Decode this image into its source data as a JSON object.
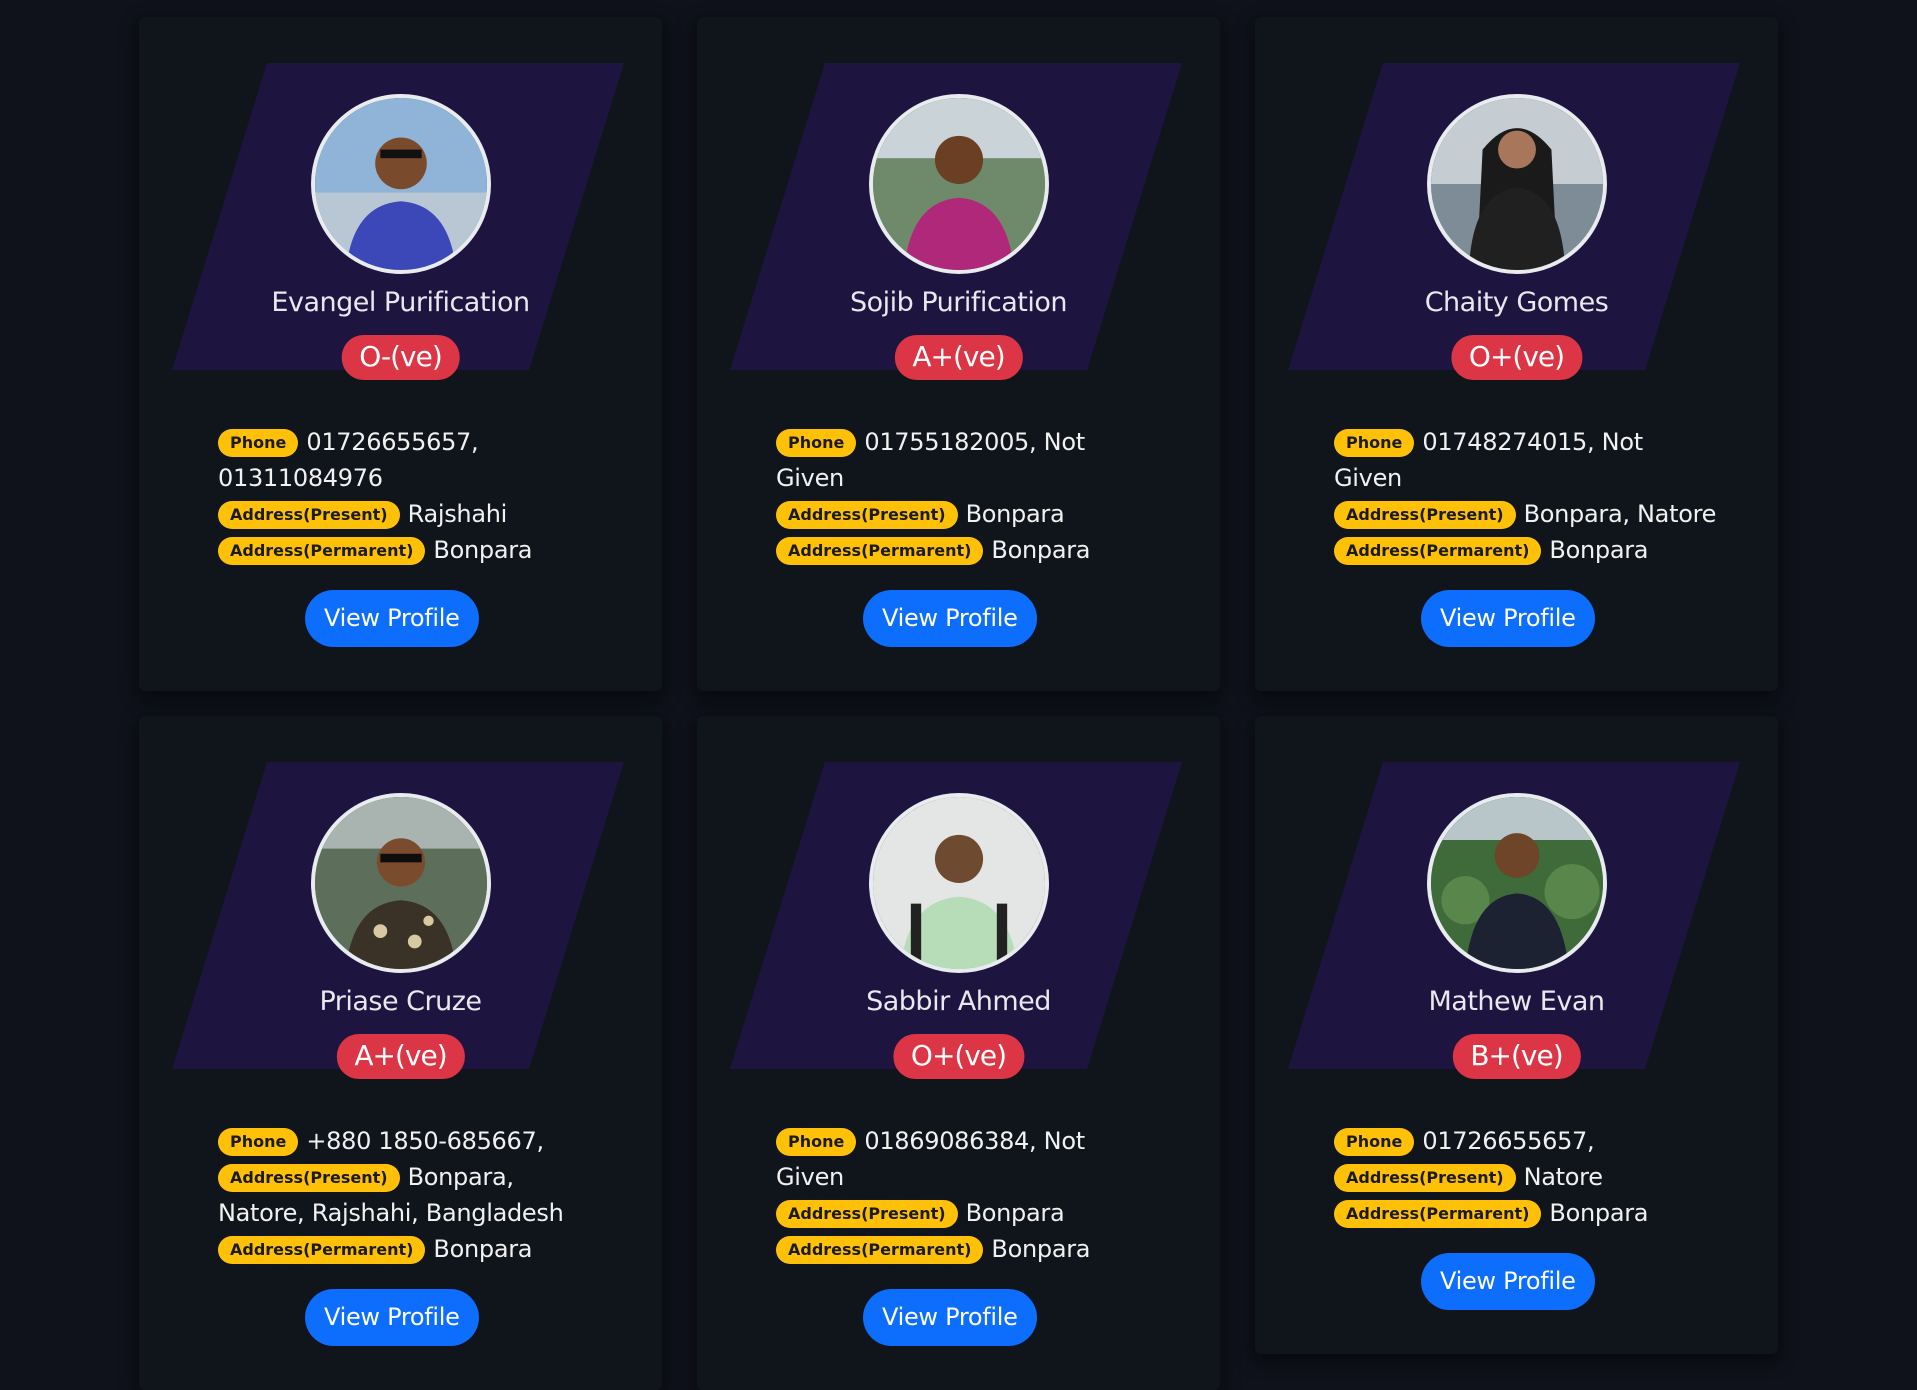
{
  "labels": {
    "phone": "Phone",
    "address_present": "Address(Present)",
    "address_permanent": "Address(Permarent)",
    "view_profile": "View Profile"
  },
  "colors": {
    "page_bg": "#0f111b",
    "card_bg": "#10141b",
    "band": "#1d1440",
    "blood_badge": "#dc3545",
    "label_badge": "#ffc107",
    "button": "#0d6efd"
  },
  "cards": [
    {
      "name": "Evangel Purification",
      "blood_group": "O-(ve)",
      "phone": "01726655657, 01311084976",
      "address_present": "Rajshahi",
      "address_permanent": "Bonpara",
      "avatar_icon": "person-photo-icon"
    },
    {
      "name": "Sojib Purification",
      "blood_group": "A+(ve)",
      "phone": "01755182005, Not Given",
      "address_present": "Bonpara",
      "address_permanent": "Bonpara",
      "avatar_icon": "person-photo-icon"
    },
    {
      "name": "Chaity Gomes",
      "blood_group": "O+(ve)",
      "phone": "01748274015, Not Given",
      "address_present": "Bonpara, Natore",
      "address_permanent": "Bonpara",
      "avatar_icon": "person-photo-icon"
    },
    {
      "name": "Priase Cruze",
      "blood_group": "A+(ve)",
      "phone": "+880 1850-685667,",
      "address_present": "Bonpara, Natore, Rajshahi, Bangladesh",
      "address_permanent": "Bonpara",
      "avatar_icon": "person-photo-icon"
    },
    {
      "name": "Sabbir Ahmed",
      "blood_group": "O+(ve)",
      "phone": "01869086384, Not Given",
      "address_present": "Bonpara",
      "address_permanent": "Bonpara",
      "avatar_icon": "person-photo-icon"
    },
    {
      "name": "Mathew Evan",
      "blood_group": "B+(ve)",
      "phone": "01726655657,",
      "address_present": "Natore",
      "address_permanent": "Bonpara",
      "avatar_icon": "person-photo-icon"
    }
  ]
}
